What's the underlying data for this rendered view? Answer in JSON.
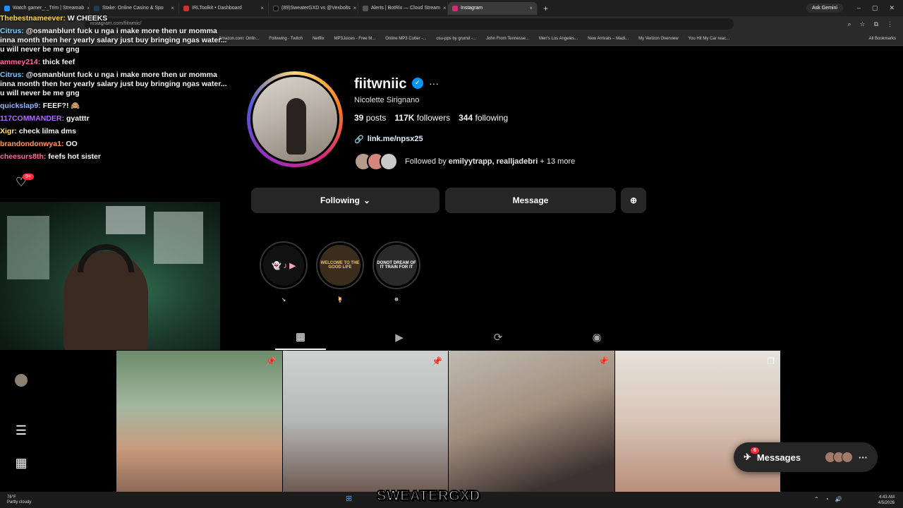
{
  "browser": {
    "tabs": [
      {
        "label": "Watch gamer_-_Trim | Streamab",
        "color": "#1e90ff"
      },
      {
        "label": "Stake: Online Casino & Spo",
        "color": "#1f3b4d"
      },
      {
        "label": "IRLToolkit • Dashboard",
        "color": "#d0312d"
      },
      {
        "label": "(89)SweaterGXD vs @Vexbolts",
        "color": "#111111"
      },
      {
        "label": "Alerts | BotRix — Cloud Stream",
        "color": "#555555"
      },
      {
        "label": "Instagram",
        "color": "#d62976"
      }
    ],
    "ask_gemini": "Ask Gemini",
    "url": "instagram.com/fiitwniic/",
    "bookmarks": [
      "Amazon.com: Onlin...",
      "Following - Twitch",
      "Netflix",
      "MP3Juices - Free M...",
      "Online MP3 Cutter -...",
      "osu-pps by grumd -...",
      "John From Tennesse...",
      "Men's Los Angeles...",
      "New Arrivals – Madi...",
      "My Verizon Overview",
      "You Hit My Car reac..."
    ],
    "all_bookmarks": "All Bookmarks"
  },
  "chat": [
    {
      "user": "Thebestnameever:",
      "msg": "W CHEEKS",
      "color": "#ffd34d"
    },
    {
      "user": "Citrus:",
      "msg": "@osmanblunt fuck u nga i make more then ur momma inna month then her yearly salary just buy bringing ngas water... u will never be me gng",
      "color": "#7cd0ff"
    },
    {
      "user": "ammey214:",
      "msg": "thick feef",
      "color": "#ff6aa2"
    },
    {
      "user": "Citrus:",
      "msg": "@osmanblunt fuck u nga i make more then ur momma inna month then her yearly salary just buy bringing ngas water... u will never be me gng",
      "color": "#7cd0ff"
    },
    {
      "user": "quickslap9:",
      "msg": "FEEF?! 🙈",
      "color": "#8fb8ff"
    },
    {
      "user": "117COMMANDER:",
      "msg": "gyatttr",
      "color": "#b06bff"
    },
    {
      "user": "Xigr:",
      "msg": "check lilma dms",
      "color": "#ffe27a"
    },
    {
      "user": "brandondonwya1:",
      "msg": "OO",
      "color": "#ff9b57"
    },
    {
      "user": "cheesurs8th:",
      "msg": "feefs hot sister",
      "color": "#ff6a9a"
    }
  ],
  "nav_badge": "9+",
  "profile": {
    "username": "fiitwniic",
    "full_name": "Nicolette Sirignano",
    "posts": "39",
    "posts_label": "posts",
    "followers": "117K",
    "followers_label": "followers",
    "following": "344",
    "following_label": "following",
    "link": "link.me/npsx25",
    "followed_by_prefix": "Followed by",
    "followed_by_names": "emilyytrapp, realljadebri",
    "followed_by_suffix": "+ 13 more",
    "following_button": "Following",
    "message_button": "Message"
  },
  "highlights": [
    {
      "label": "↘",
      "text": "👻 ♪ ▶"
    },
    {
      "label": "🍹",
      "text": "WELCOME TO THE GOOD LIFE"
    },
    {
      "label": "✵",
      "text": "DONOT DREAM OF IT TRAIN FOR IT"
    }
  ],
  "messages_bar": {
    "label": "Messages",
    "badge": "6"
  },
  "taskbar": {
    "weather_temp": "76°F",
    "weather_desc": "Partly cloudy",
    "streamer": "SWEATERGXD",
    "time": "4:43 AM",
    "date": "4/5/2026"
  }
}
